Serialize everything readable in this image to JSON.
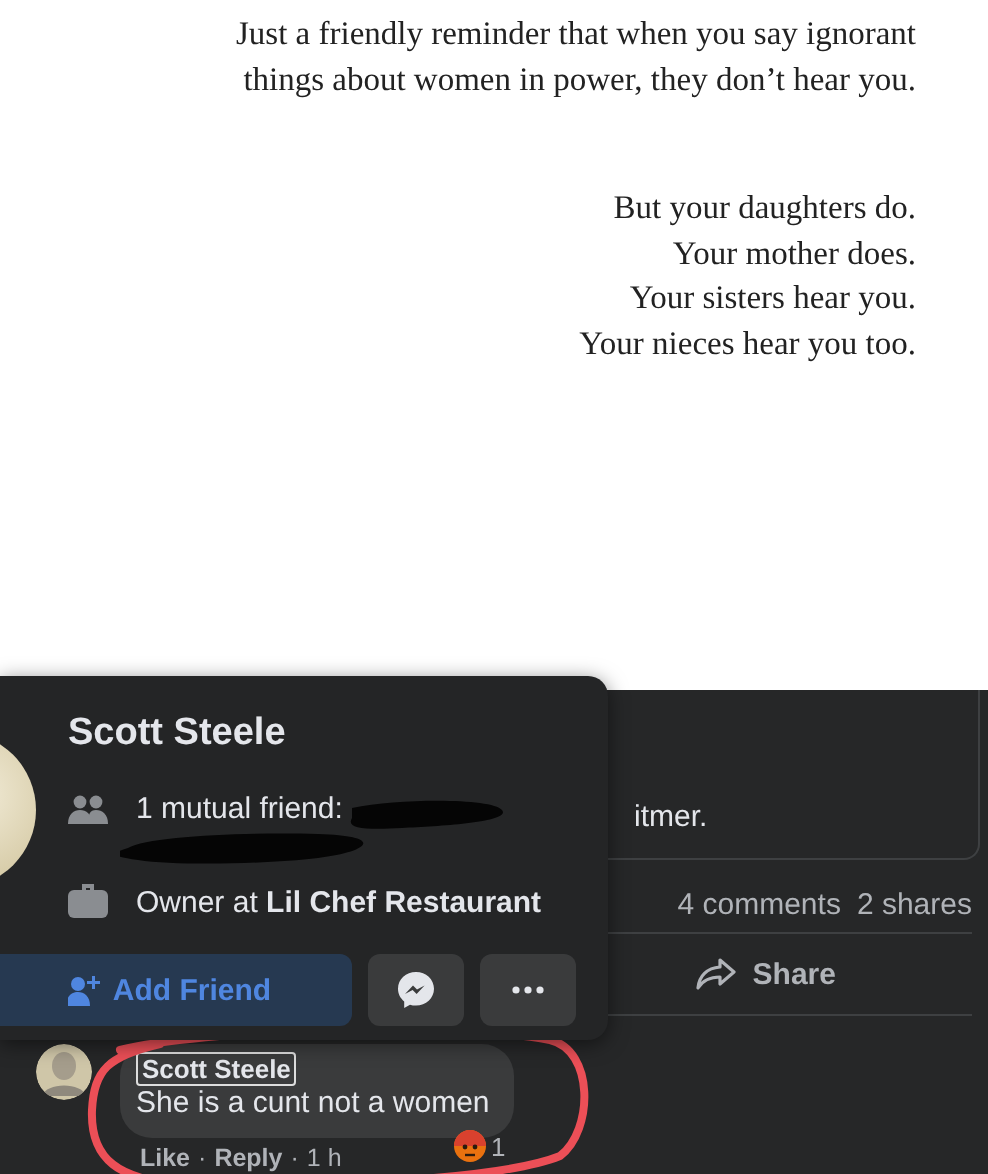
{
  "quote": {
    "paragraphs": [
      [
        "Just a friendly reminder that when you say ignorant",
        "things about women in power, they don’t hear you."
      ],
      [
        "But your daughters do.",
        "Your mother does.",
        "Your sisters hear you.",
        "Your nieces hear you too."
      ]
    ]
  },
  "link_preview": {
    "text": "itmer."
  },
  "stats": {
    "comments": "4 comments",
    "shares": "2 shares"
  },
  "actions": [
    {
      "kind": "share",
      "label": "Share"
    }
  ],
  "comment": {
    "author": "Scott Steele",
    "text": "She is a cunt not a women",
    "reaction_count": "1",
    "footer": [
      {
        "kind": "link",
        "text": "Like"
      },
      {
        "kind": "sep",
        "text": "·"
      },
      {
        "kind": "link",
        "text": "Reply"
      },
      {
        "kind": "sep",
        "text": "·"
      },
      {
        "kind": "time",
        "text": "1 h"
      }
    ]
  },
  "hover_card": {
    "name": "Scott Steele",
    "details": [
      {
        "kind": "mutual",
        "text": "1 mutual friend:"
      },
      {
        "kind": "work",
        "text": "Owner at **Lil Chef Restaurant**"
      }
    ],
    "buttons": [
      {
        "kind": "add_friend",
        "label": "Add Friend"
      },
      {
        "kind": "messenger"
      },
      {
        "kind": "more"
      }
    ]
  }
}
